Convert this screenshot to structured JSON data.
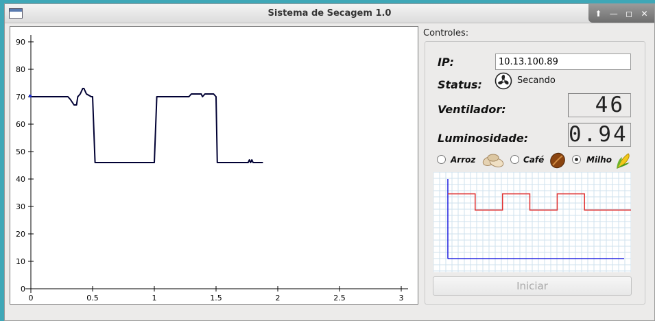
{
  "window": {
    "title": "Sistema de Secagem 1.0",
    "buttons": [
      "⬆",
      "—",
      "◻",
      "✕"
    ]
  },
  "controls": {
    "group_title": "Controles:",
    "ip_label": "IP:",
    "ip_value": "10.13.100.89",
    "status_label": "Status:",
    "status_value": "Secando",
    "status_icon": "fan-icon",
    "fan_label": "Ventilador:",
    "fan_value": "46",
    "light_label": "Luminosidade:",
    "light_value": "0.94",
    "grains": [
      {
        "label": "Arroz",
        "checked": false,
        "icon": "rice-icon"
      },
      {
        "label": "Café",
        "checked": false,
        "icon": "coffee-bean-icon"
      },
      {
        "label": "Milho",
        "checked": true,
        "icon": "corn-icon"
      }
    ],
    "start_label": "Iniciar",
    "start_enabled": false
  },
  "chart_data": {
    "type": "line",
    "xlim": [
      0,
      3
    ],
    "ylim": [
      0,
      90
    ],
    "xticks": [
      "0",
      "0.5",
      "1",
      "1.5",
      "2",
      "2.5",
      "3"
    ],
    "yticks": [
      "0",
      "10",
      "20",
      "30",
      "40",
      "50",
      "60",
      "70",
      "80",
      "90"
    ],
    "grid": false,
    "line_color": "#000033",
    "series": [
      {
        "x": [
          0,
          0.3,
          0.32,
          0.35,
          0.37,
          0.38,
          0.4,
          0.42,
          0.43,
          0.45,
          0.49,
          0.5,
          0.52,
          0.85,
          0.99,
          1.0,
          1.02,
          1.28,
          1.3,
          1.38,
          1.39,
          1.41,
          1.48,
          1.5,
          1.51,
          1.53,
          1.76,
          1.77,
          1.78,
          1.79,
          1.8,
          1.88
        ],
        "y": [
          70,
          70,
          69,
          67,
          67,
          70,
          71,
          73,
          73,
          71,
          70,
          70,
          46,
          46,
          46,
          46,
          70,
          70,
          71,
          71,
          70,
          71,
          71,
          70,
          46,
          46,
          46,
          47,
          46,
          47,
          46,
          46
        ]
      }
    ]
  },
  "mini_chart": {
    "type": "line",
    "grid": true,
    "line_color": "#e03030",
    "axis_color": "#2020e0",
    "x": [
      0,
      1,
      1,
      2,
      2,
      3,
      3,
      4,
      4,
      5,
      5,
      6,
      6,
      6.8,
      6.8
    ],
    "y": [
      4,
      4,
      3,
      3,
      4,
      4,
      3,
      3,
      4,
      4,
      3,
      3,
      3,
      3,
      0
    ],
    "xlim": [
      -0.25,
      6.5
    ],
    "ylim": [
      -0.5,
      5
    ]
  }
}
